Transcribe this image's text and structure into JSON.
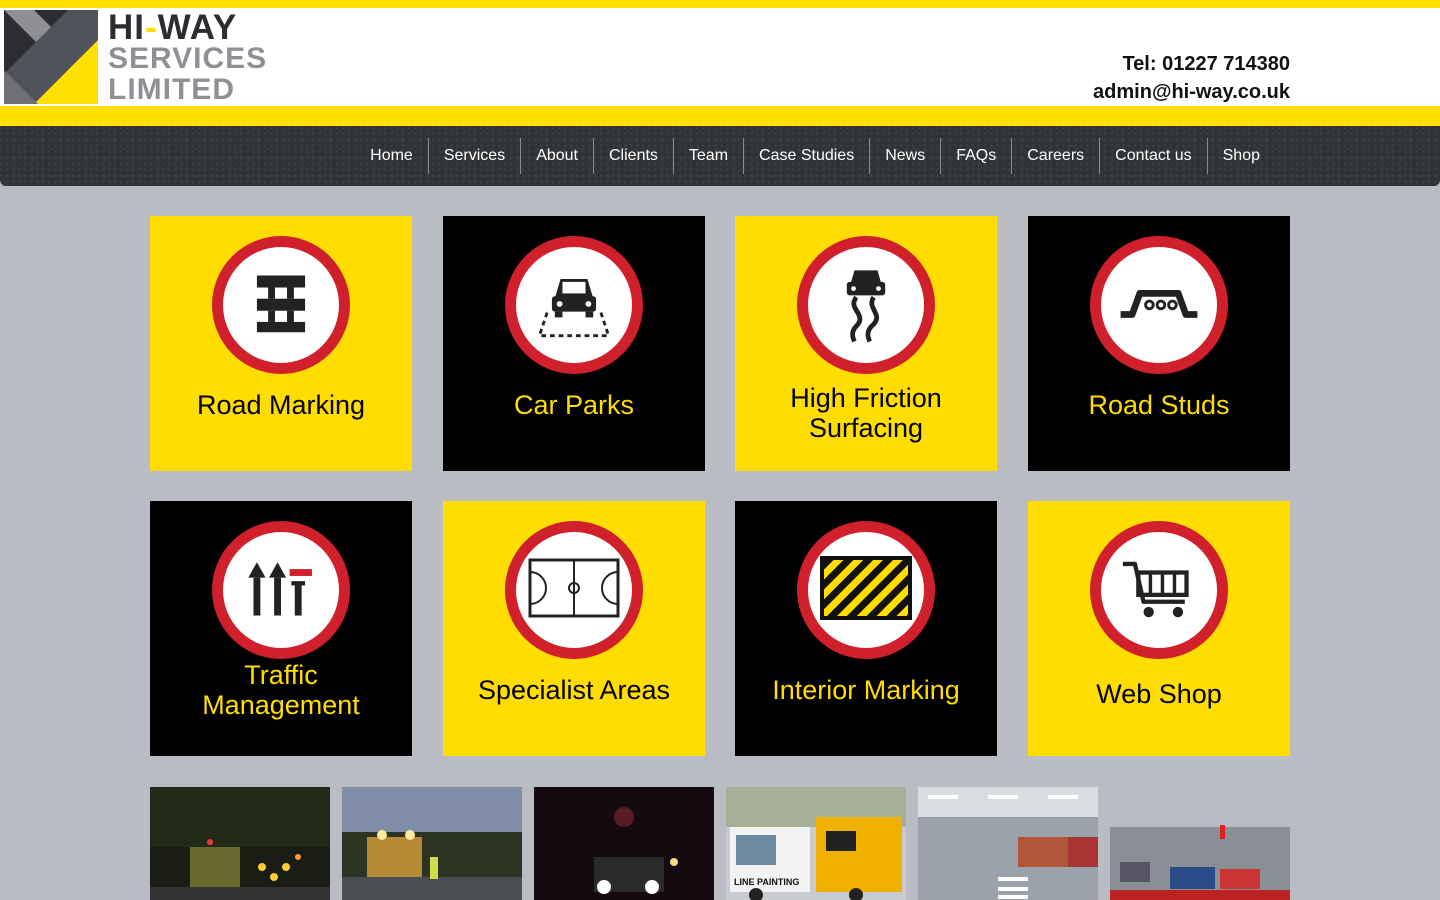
{
  "brand": {
    "line1_a": "HI",
    "line1_dash": "-",
    "line1_b": "WAY",
    "line2": "SERVICES",
    "line3": "LIMITED",
    "accent": "#ffe000",
    "dark": "#2b2d33",
    "grey": "#8e9096"
  },
  "contact": {
    "tel": "Tel: 01227 714380",
    "email": "admin@hi-way.co.uk"
  },
  "nav": {
    "items": [
      "Home",
      "Services",
      "About",
      "Clients",
      "Team",
      "Case Studies",
      "News",
      "FAQs",
      "Careers",
      "Contact us",
      "Shop"
    ]
  },
  "tiles": [
    {
      "label": "Road Marking",
      "icon": "road-marking-icon",
      "theme": "yellow"
    },
    {
      "label": "Car Parks",
      "icon": "car-park-icon",
      "theme": "black"
    },
    {
      "label": "High Friction Surfacing",
      "icon": "skidding-car-icon",
      "theme": "yellow"
    },
    {
      "label": "Road Studs",
      "icon": "road-stud-icon",
      "theme": "black"
    },
    {
      "label": "Traffic Management",
      "icon": "lane-arrows-icon",
      "theme": "black"
    },
    {
      "label": "Specialist Areas",
      "icon": "sports-court-icon",
      "theme": "yellow"
    },
    {
      "label": "Interior Marking",
      "icon": "hazard-stripes-icon",
      "theme": "black"
    },
    {
      "label": "Web Shop",
      "icon": "shopping-cart-icon",
      "theme": "yellow"
    }
  ],
  "photos": [
    {
      "name": "night-works-photo"
    },
    {
      "name": "motorway-dusk-photo"
    },
    {
      "name": "night-vehicle-photo"
    },
    {
      "name": "line-painting-truck-photo",
      "caption": "LINE PAINTING"
    },
    {
      "name": "car-park-interior-photo"
    },
    {
      "name": "multistorey-car-park-photo"
    }
  ],
  "colors": {
    "sign_red": "#d0202b",
    "tile_yellow": "#ffdd00",
    "tile_black": "#000000",
    "nav_bg": "#2f3336",
    "page_bg": "#b9bcc3"
  }
}
